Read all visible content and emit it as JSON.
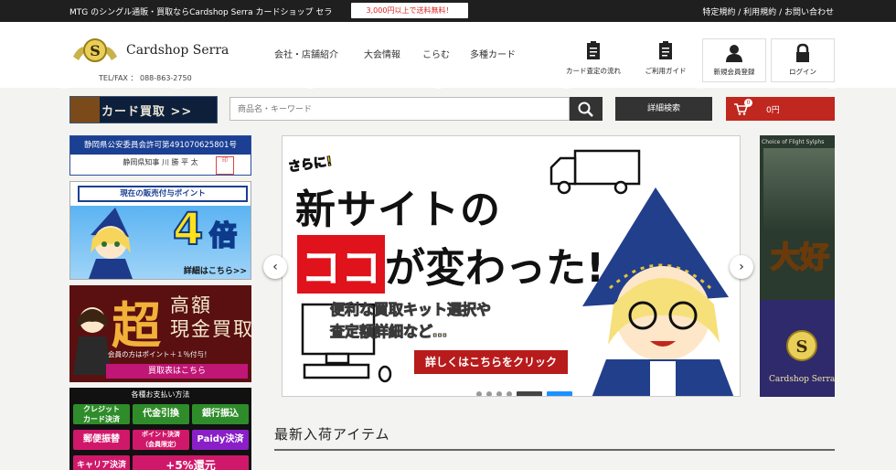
{
  "topbar": {
    "tagline": "MTG のシングル通販・買取ならCardshop Serra カードショップ セラ",
    "promo": "3,000円以上で送料無料！",
    "links": [
      "特定規約",
      "利用規約",
      "お問い合わせ"
    ],
    "separator": "/"
  },
  "header": {
    "brand": "Cardshop Serra",
    "emblem_letter": "S",
    "tel": "TEL/FAX ： 088-863-2750",
    "nav": [
      "会社・店舗紹介",
      "大会情報",
      "こらむ",
      "多種カード"
    ],
    "icons": [
      {
        "label": "カード査定の流れ",
        "icon": "clipboard-icon"
      },
      {
        "label": "ご利用ガイド",
        "icon": "clipboard-icon"
      },
      {
        "label": "新規会員登録",
        "icon": "user-icon"
      },
      {
        "label": "ログイン",
        "icon": "lock-icon"
      }
    ]
  },
  "toolbar": {
    "buy_banner": "カード買取 >>",
    "search_placeholder": "商品名・キーワード",
    "detail_search": "詳細検索",
    "cart_count": "0",
    "cart_amount": "0円"
  },
  "sidebar": {
    "permit_line1": "静岡県公安委員会許可第491070625801号",
    "permit_line2": "静岡県知事 川 勝 平 太",
    "stamp": "印",
    "points_header": "現在の販売付与ポイント",
    "points_value": "4",
    "points_unit": "倍",
    "points_more": "詳細はこちら>>",
    "cash_big": "超",
    "cash_t1": "高額",
    "cash_t2": "現金買取",
    "cash_note": "会員の方はポイント＋１％付与！",
    "cash_button": "買取表はこちら",
    "payments_header": "各種お支払い方法",
    "payments": [
      {
        "label": "クレジット\nカード決済",
        "color": "#2f8c2a"
      },
      {
        "label": "代金引換",
        "color": "#2f8c2a"
      },
      {
        "label": "銀行振込",
        "color": "#2f8c2a"
      },
      {
        "label": "郵便振替",
        "color": "#d0186a"
      },
      {
        "label": "ポイント決済\n（会員限定）",
        "color": "#d0186a"
      },
      {
        "label": "Paidy決済",
        "color": "#8a1fc8"
      },
      {
        "label": "キャリア決済",
        "color": "#d0186a"
      },
      {
        "label": "+5%還元",
        "color": "#d0186a"
      }
    ]
  },
  "slider": {
    "kicker": "さらに!",
    "headline1": "新サイトの",
    "headline2_red": "ココ",
    "headline2_rest": "が変わった!",
    "sub1": "便利な買取キット選択や",
    "sub2": "査定額詳細など…",
    "cta": "詳しくはこちらをクリック",
    "side_text": "大好",
    "side_brand": "Cardshop Serra",
    "side_card_title": "Choice of Flight Sylphs",
    "prev": "‹",
    "next": "›",
    "active_dot": 4,
    "dot_count": 5
  },
  "main": {
    "section_title": "最新入荷アイテム"
  }
}
